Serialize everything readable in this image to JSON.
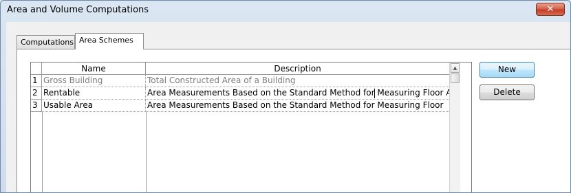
{
  "window": {
    "title": "Area and Volume Computations",
    "close_glyph": "✕"
  },
  "tabs": [
    {
      "label": "Computations",
      "active": false
    },
    {
      "label": "Area Schemes",
      "active": true
    }
  ],
  "table": {
    "columns": [
      "Name",
      "Description"
    ],
    "rows": [
      {
        "num": "1",
        "name": "Gross Building",
        "description": "Total Constructed Area of a Building",
        "muted": true
      },
      {
        "num": "2",
        "name": "Rentable",
        "description": "Area Measurements Based on the Standard Method for Measuring Floor Area",
        "muted": false
      },
      {
        "num": "3",
        "name": "Usable Area",
        "description": "Area Measurements Based on the Standard Method for Measuring Floor",
        "muted": false
      }
    ]
  },
  "buttons": {
    "new_label": "New",
    "delete_label": "Delete"
  },
  "icons": {
    "close": "close-icon",
    "scroll_up": "chevron-up-icon"
  },
  "colors": {
    "title_bg": "#dbe6f3",
    "close_red": "#c1402b",
    "muted_text": "#7d7d7d",
    "default_button_border": "#3c7fb1"
  }
}
